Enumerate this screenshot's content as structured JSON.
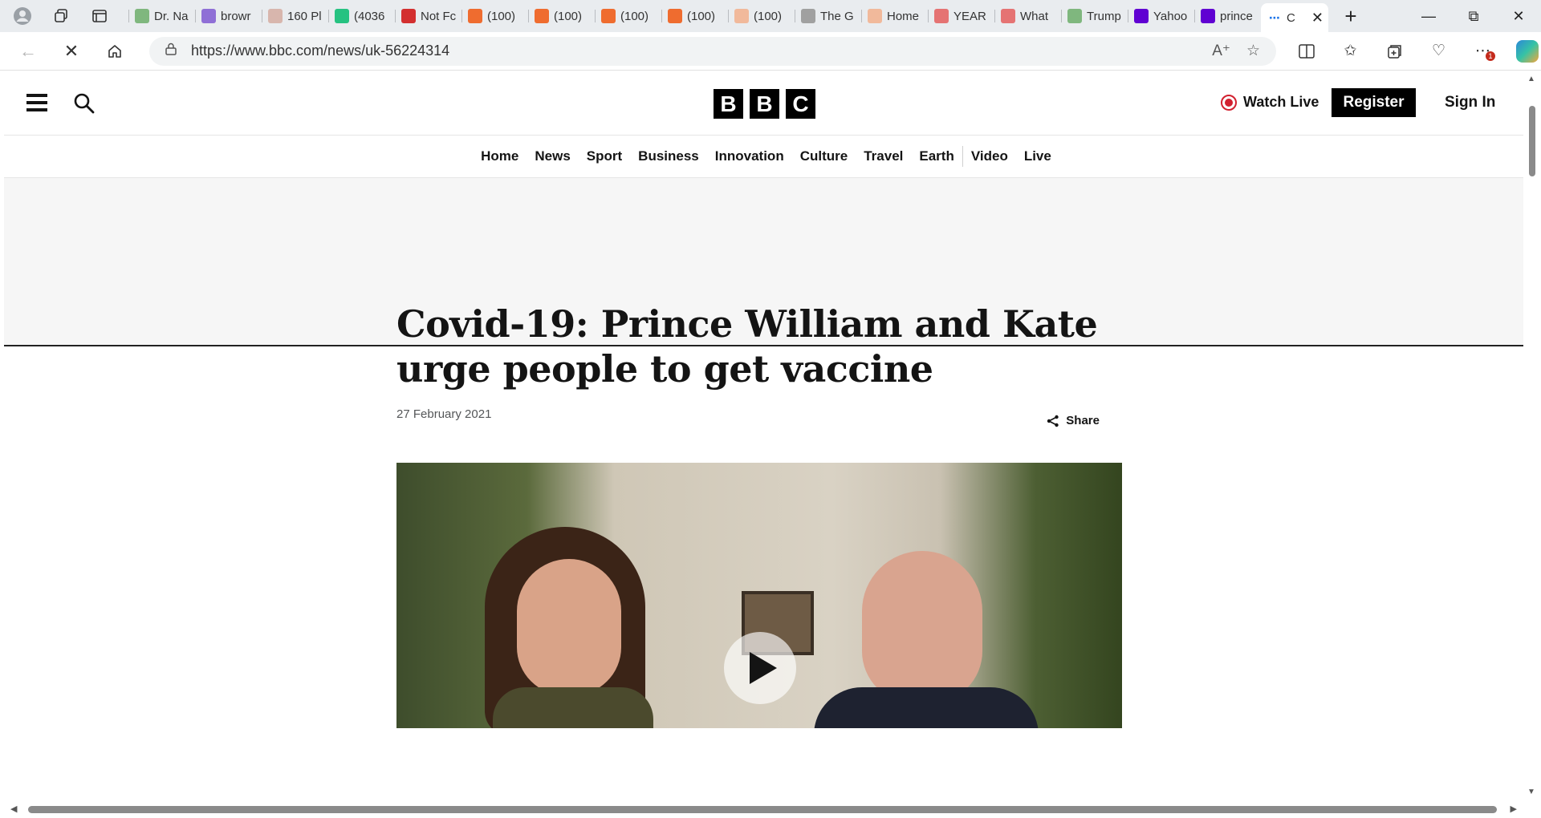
{
  "browser": {
    "tabs": [
      {
        "title": "Dr. Na",
        "favicon": "play-icon",
        "color": "#7fb77e"
      },
      {
        "title": "browr",
        "favicon": "yahoo-icon",
        "color": "#8f6fd6"
      },
      {
        "title": "160 Pl",
        "favicon": "bi-icon",
        "color": "#d8b6ad"
      },
      {
        "title": "(4036",
        "favicon": "g-icon",
        "color": "#26c281"
      },
      {
        "title": "Not Fc",
        "favicon": "alert-icon",
        "color": "#d32f2f"
      },
      {
        "title": "(100)",
        "favicon": "bookmark-icon",
        "color": "#ef6c2f"
      },
      {
        "title": "(100)",
        "favicon": "bookmark-icon",
        "color": "#ef6c2f"
      },
      {
        "title": "(100)",
        "favicon": "bookmark-icon",
        "color": "#ef6c2f"
      },
      {
        "title": "(100)",
        "favicon": "bookmark-icon",
        "color": "#ef6c2f"
      },
      {
        "title": "(100)",
        "favicon": "bookmark-icon",
        "color": "#f1b99b"
      },
      {
        "title": "The G",
        "favicon": "ds-icon",
        "color": "#a0a0a0"
      },
      {
        "title": "Home",
        "favicon": "bookmark-icon",
        "color": "#f1b99b"
      },
      {
        "title": "YEAR",
        "favicon": "youtube-icon",
        "color": "#e57373"
      },
      {
        "title": "What",
        "favicon": "youtube-icon",
        "color": "#e57373"
      },
      {
        "title": "Trump",
        "favicon": "play-icon",
        "color": "#7fb77e"
      },
      {
        "title": "Yahoo",
        "favicon": "yahoo-icon",
        "color": "#6001d2"
      },
      {
        "title": "prince",
        "favicon": "yahoo-icon",
        "color": "#6001d2"
      }
    ],
    "active_tab": {
      "title": "C",
      "favicon": "loading-icon"
    },
    "url": "https://www.bbc.com/news/uk-56224314"
  },
  "header": {
    "logo_letters": [
      "B",
      "B",
      "C"
    ],
    "watch_live": "Watch Live",
    "register": "Register",
    "sign_in": "Sign In"
  },
  "nav": {
    "items": [
      "Home",
      "News",
      "Sport",
      "Business",
      "Innovation",
      "Culture",
      "Travel",
      "Earth",
      "Video",
      "Live"
    ]
  },
  "article": {
    "headline": "Covid-19: Prince William and Kate urge people to get vaccine",
    "date": "27 February 2021",
    "share": "Share"
  },
  "colors": {
    "live_red": "#d2202f",
    "brand_black": "#000000"
  }
}
